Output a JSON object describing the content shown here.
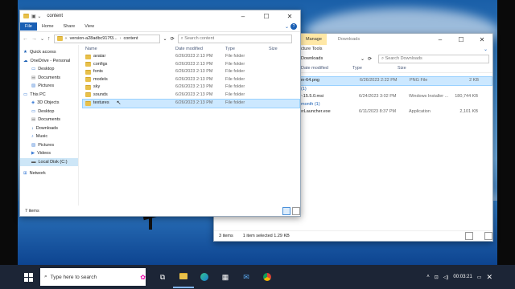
{
  "explorer_front": {
    "title": "content",
    "tabs": [
      "File",
      "Home",
      "Share",
      "View"
    ],
    "breadcrumb": [
      "version-a28adbc917f3...",
      "content"
    ],
    "search_placeholder": "Search content",
    "columns": [
      "Name",
      "Date modified",
      "Type",
      "Size"
    ],
    "nav": [
      {
        "label": "Quick access",
        "icon": "star-icon"
      },
      {
        "label": "OneDrive - Personal",
        "icon": "cloud-icon"
      },
      {
        "label": "Desktop",
        "icon": "desktop-icon"
      },
      {
        "label": "Documents",
        "icon": "documents-icon"
      },
      {
        "label": "Pictures",
        "icon": "pictures-icon"
      },
      {
        "label": "This PC",
        "icon": "computer-icon"
      },
      {
        "label": "3D Objects",
        "icon": "cube-icon"
      },
      {
        "label": "Desktop",
        "icon": "desktop-icon"
      },
      {
        "label": "Documents",
        "icon": "documents-icon"
      },
      {
        "label": "Downloads",
        "icon": "download-icon"
      },
      {
        "label": "Music",
        "icon": "music-icon"
      },
      {
        "label": "Pictures",
        "icon": "pictures-icon"
      },
      {
        "label": "Videos",
        "icon": "video-icon"
      },
      {
        "label": "Local Disk (C:)",
        "icon": "disk-icon"
      },
      {
        "label": "Network",
        "icon": "network-icon"
      }
    ],
    "files": [
      {
        "name": "avatar",
        "date": "6/26/2023 2:13 PM",
        "type": "File folder",
        "size": ""
      },
      {
        "name": "configs",
        "date": "6/26/2023 2:13 PM",
        "type": "File folder",
        "size": ""
      },
      {
        "name": "fonts",
        "date": "6/26/2023 2:13 PM",
        "type": "File folder",
        "size": ""
      },
      {
        "name": "models",
        "date": "6/26/2023 2:13 PM",
        "type": "File folder",
        "size": ""
      },
      {
        "name": "sky",
        "date": "6/26/2023 2:13 PM",
        "type": "File folder",
        "size": ""
      },
      {
        "name": "sounds",
        "date": "6/26/2023 2:13 PM",
        "type": "File folder",
        "size": ""
      },
      {
        "name": "textures",
        "date": "6/26/2023 2:13 PM",
        "type": "File folder",
        "size": ""
      }
    ],
    "status": "7 items"
  },
  "explorer_back": {
    "title": "Downloads",
    "manage_tab": "Manage",
    "picture_tools": "cture Tools",
    "breadcrumb": "Downloads",
    "search_placeholder": "Search Downloads",
    "columns": [
      "Date modified",
      "Type",
      "Size"
    ],
    "rows": [
      {
        "name": "ion-64.png",
        "date": "6/26/2023 2:22 PM",
        "type": "PNG File",
        "size": "2 KB",
        "selected": true
      },
      {
        "group": "(1)"
      },
      {
        "name": "er-15.5.0.msi",
        "date": "6/24/2023 3:02 PM",
        "type": "Windows Installer ...",
        "size": "180,744 KB"
      },
      {
        "group": "month (1)"
      },
      {
        "name": "yerLauncher.exe",
        "date": "6/11/2023 8:37 PM",
        "type": "Application",
        "size": "2,101 KB"
      }
    ],
    "status_items": "3 items",
    "status_selected": "1 item selected  1.29 KB"
  },
  "taskbar": {
    "search_placeholder": "Type here to search",
    "clock": "00:03:21"
  },
  "colors": {
    "accent": "#1a5fb4",
    "taskbar": "#1c2536",
    "selection": "#cce8ff"
  }
}
